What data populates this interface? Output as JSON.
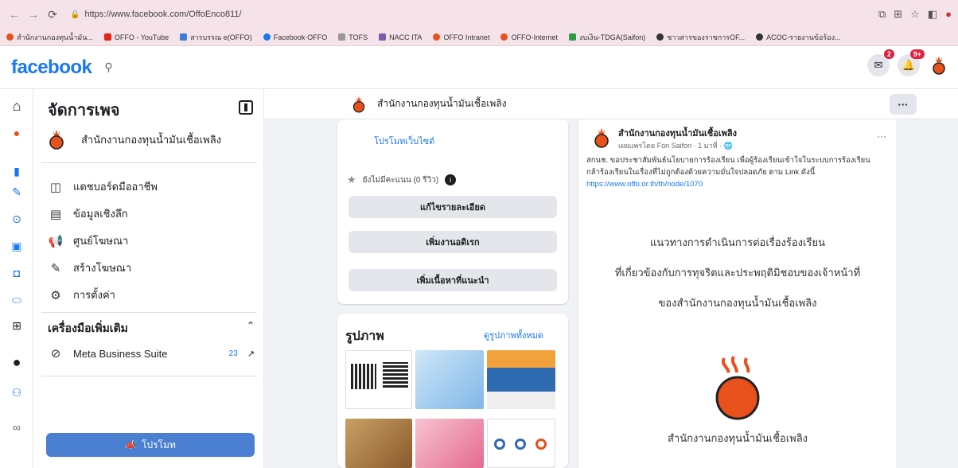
{
  "browser": {
    "url": "https://www.facebook.com/OffoEnco811/",
    "bookmarks": [
      "สำนักงานกองทุนน้ำมัน...",
      "OFFO - YouTube",
      "สารบรรณ e(OFFO)",
      "Facebook-OFFO",
      "TOFS",
      "NACC ITA",
      "OFFO Intranet",
      "OFFO-Internet",
      "งบเงิน-TDGA(Saifon)",
      "ชาวสารของราชการOF...",
      "ACOC-รายงานข้อร้อง..."
    ]
  },
  "fb": {
    "logo": "facebook",
    "messenger_badge": "2",
    "notif_badge": "9+"
  },
  "panel": {
    "title": "จัดการเพจ",
    "page_name": "สำนักงานกองทุนน้ำมันเชื้อเพลิง",
    "menu": [
      {
        "label": "แดชบอร์ดมืออาชีพ",
        "icon": "dashboard-icon"
      },
      {
        "label": "ข้อมูลเชิงลึก",
        "icon": "insights-icon"
      },
      {
        "label": "ศูนย์โฆษณา",
        "icon": "megaphone-icon"
      },
      {
        "label": "สร้างโฆษณา",
        "icon": "pencil-icon"
      },
      {
        "label": "การตั้งค่า",
        "icon": "gear-icon"
      }
    ],
    "tools_heading": "เครื่องมือเพิ่มเติม",
    "mbs_label": "Meta Business Suite",
    "mbs_count": "23",
    "promote": "โปรโมท"
  },
  "header": {
    "page_name": "สำนักงานกองทุนน้ำมันเชื้อเพลิง",
    "more": "···"
  },
  "middle": {
    "promote_site": "โปรโมทเว็บไซต์",
    "rating": "ยังไม่มีคะแนน (0 รีวิว)",
    "edit_details": "แก้ไขรายละเอียด",
    "add_button": "เพิ่มงานอดิเรก",
    "add_featured": "เพิ่มเนื้อหาที่แนะนำ",
    "photos_title": "รูปภาพ",
    "see_all_photos": "ดูรูปภาพทั้งหมด"
  },
  "post": {
    "author": "สำนักงานกองทุนน้ำมันเชื้อเพลิง",
    "meta": "เผยแพร่โดย Fon Saifon · 1 มาที่ ·",
    "body_text": "สกนช. ขอประชาสัมพันธ์นโยบายการร้องเรียน เพื่อผู้ร้องเรียนเข้าใจในระบบการร้องเรียน กล้าร้องเรียนในเรื่องที่ไม่ถูกต้องด้วยความมั่นใจปลอดภัย ตาม Link ดังนี้",
    "link": "https://www.offo.or.th/th/node/1070",
    "line1": "แนวทางการดำเนินการต่อเรื่องร้องเรียน",
    "line2": "ที่เกี่ยวข้องกับการทุจริตและประพฤติมิชอบของเจ้าหน้าที่",
    "line3": "ของสำนักงานกองทุนน้ำมันเชื้อเพลิง",
    "logo_caption": "สำนักงานกองทุนน้ำมันเชื้อเพลิง"
  },
  "colors": {
    "fb_blue": "#1877f2",
    "promote_blue": "#4a7fd1",
    "logo_orange": "#e8501c",
    "badge_red": "#e41e3f"
  }
}
